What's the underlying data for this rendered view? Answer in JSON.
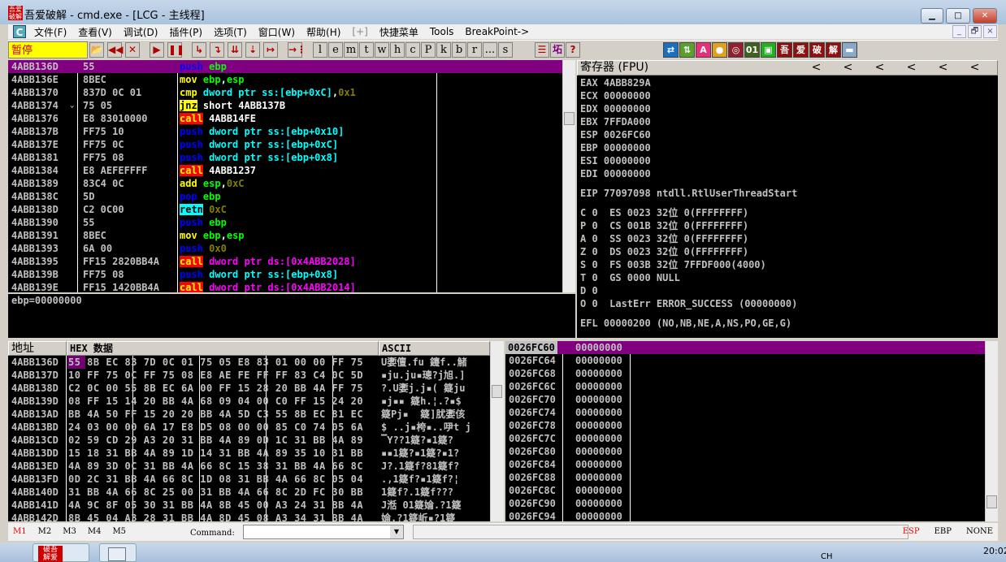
{
  "window": {
    "title": "吾爱破解 - cmd.exe - [LCG -  主线程]",
    "logo_text": "吾爱破解",
    "minimize": "▁",
    "maximize": "□",
    "close": "✕"
  },
  "menu": {
    "logo": "C",
    "items": [
      "文件(F)",
      "查看(V)",
      "调试(D)",
      "插件(P)",
      "选项(T)",
      "窗口(W)",
      "帮助(H)",
      "[+]",
      "快捷菜单",
      "Tools",
      "BreakPoint->"
    ],
    "mdi": [
      "_",
      "🗗",
      "×"
    ]
  },
  "toolbar": {
    "status": "暂停",
    "nav_buttons": [
      "📂",
      "◀◀",
      "✕",
      "▶",
      "❚❚",
      "↳",
      "↴",
      "⇊",
      "⇣",
      "↦",
      "→⋮"
    ],
    "letter_buttons": [
      "l",
      "e",
      "m",
      "t",
      "w",
      "h",
      "c",
      "P",
      "k",
      "b",
      "r",
      "...",
      "s"
    ],
    "extra_buttons": [
      "☰",
      "坧",
      "?"
    ],
    "color_icons": [
      {
        "t": "⇄",
        "c": "#1a6fc0"
      },
      {
        "t": "⇅",
        "c": "#5aa02a"
      },
      {
        "t": "A",
        "c": "#e8307a"
      },
      {
        "t": "●",
        "c": "#e0a020"
      },
      {
        "t": "◎",
        "c": "#902030"
      },
      {
        "t": "01",
        "c": "#406020"
      },
      {
        "t": "▣",
        "c": "#20b020"
      },
      {
        "t": "吾",
        "c": "#901010"
      },
      {
        "t": "爱",
        "c": "#901010"
      },
      {
        "t": "破",
        "c": "#901010"
      },
      {
        "t": "解",
        "c": "#901010"
      },
      {
        "t": "▬",
        "c": "#8aa8c8"
      }
    ]
  },
  "disasm": {
    "rows": [
      {
        "addr": "4ABB136D",
        "hex": "55",
        "mn": "push",
        "ops": [
          [
            "ebp",
            "reg"
          ]
        ]
      },
      {
        "addr": "4ABB136E",
        "hex": "8BEC",
        "mn": "mov",
        "ops": [
          [
            "ebp",
            "reg"
          ],
          [
            ",",
            "p"
          ],
          [
            "esp",
            "reg"
          ]
        ]
      },
      {
        "addr": "4ABB1370",
        "hex": "837D 0C 01",
        "mn": "cmp",
        "ops": [
          [
            "dword ptr ss:[ebp+0xC]",
            "mem"
          ],
          [
            ",",
            "p"
          ],
          [
            "0x1",
            "const"
          ]
        ]
      },
      {
        "addr": "4ABB1374",
        "mark": "⌄",
        "hex": "75 05",
        "mn": "jnz",
        "ops": [
          [
            "short 4ABB137B",
            "addr"
          ]
        ]
      },
      {
        "addr": "4ABB1376",
        "hex": "E8 83010000",
        "mn": "call",
        "ops": [
          [
            "4ABB14FE",
            "addr"
          ]
        ]
      },
      {
        "addr": "4ABB137B",
        "hex": "FF75 10",
        "mn": "push",
        "ops": [
          [
            "dword ptr ss:[ebp+0x10]",
            "mem"
          ]
        ]
      },
      {
        "addr": "4ABB137E",
        "hex": "FF75 0C",
        "mn": "push",
        "ops": [
          [
            "dword ptr ss:[ebp+0xC]",
            "mem"
          ]
        ]
      },
      {
        "addr": "4ABB1381",
        "hex": "FF75 08",
        "mn": "push",
        "ops": [
          [
            "dword ptr ss:[ebp+0x8]",
            "mem"
          ]
        ]
      },
      {
        "addr": "4ABB1384",
        "hex": "E8 AEFEFFFF",
        "mn": "call",
        "ops": [
          [
            "4ABB1237",
            "addr"
          ]
        ]
      },
      {
        "addr": "4ABB1389",
        "hex": "83C4 0C",
        "mn": "add",
        "ops": [
          [
            "esp",
            "reg"
          ],
          [
            ",",
            "p"
          ],
          [
            "0xC",
            "const"
          ]
        ]
      },
      {
        "addr": "4ABB138C",
        "hex": "5D",
        "mn": "pop",
        "ops": [
          [
            "ebp",
            "reg"
          ]
        ]
      },
      {
        "addr": "4ABB138D",
        "hex": "C2 0C00",
        "mn": "retn",
        "ops": [
          [
            "0xC",
            "const"
          ]
        ]
      },
      {
        "addr": "4ABB1390",
        "hex": "55",
        "mn": "push",
        "ops": [
          [
            "ebp",
            "reg"
          ]
        ]
      },
      {
        "addr": "4ABB1391",
        "hex": "8BEC",
        "mn": "mov",
        "ops": [
          [
            "ebp",
            "reg"
          ],
          [
            ",",
            "p"
          ],
          [
            "esp",
            "reg"
          ]
        ]
      },
      {
        "addr": "4ABB1393",
        "hex": "6A 00",
        "mn": "push",
        "ops": [
          [
            "0x0",
            "const"
          ]
        ]
      },
      {
        "addr": "4ABB1395",
        "hex": "FF15 2820BB4A",
        "mn": "call",
        "ops": [
          [
            "dword ptr ds:[0x4ABB2028]",
            "ds"
          ]
        ]
      },
      {
        "addr": "4ABB139B",
        "hex": "FF75 08",
        "mn": "push",
        "ops": [
          [
            "dword ptr ss:[ebp+0x8]",
            "mem"
          ]
        ]
      },
      {
        "addr": "4ABB139E",
        "hex": "FF15 1420BB4A",
        "mn": "call",
        "ops": [
          [
            "dword ptr ds:[0x4ABB2014]",
            "ds"
          ]
        ]
      }
    ],
    "info": "ebp=00000000"
  },
  "registers": {
    "header": "寄存器 (FPU)",
    "arrows": [
      "<",
      "<",
      "<",
      "<",
      "<",
      "<"
    ],
    "lines": [
      "EAX 4ABB829A",
      "ECX 00000000",
      "EDX 00000000",
      "EBX 7FFDA000",
      "ESP 0026FC60",
      "EBP 00000000",
      "ESI 00000000",
      "EDI 00000000",
      "",
      "EIP 77097098 ntdll.RtlUserThreadStart",
      "",
      "C 0  ES 0023 32位 0(FFFFFFFF)",
      "P 0  CS 001B 32位 0(FFFFFFFF)",
      "A 0  SS 0023 32位 0(FFFFFFFF)",
      "Z 0  DS 0023 32位 0(FFFFFFFF)",
      "S 0  FS 003B 32位 7FFDF000(4000)",
      "T 0  GS 0000 NULL",
      "D 0",
      "O 0  LastErr ERROR_SUCCESS (00000000)",
      "",
      "EFL 00000200 (NO,NB,NE,A,NS,PO,GE,G)"
    ]
  },
  "dump": {
    "headers": [
      "地址",
      "HEX 数据",
      "ASCII"
    ],
    "rows": [
      {
        "addr": "4ABB136D",
        "hex": "55 8B EC 83 7D 0C 01 75 05 E8 83 01 00 00 FF 75",
        "ascii": "U嬱儃.fu 鑳f..觰"
      },
      {
        "addr": "4ABB137D",
        "hex": "10 FF 75 0C FF 75 08 E8 AE FE FF FF 83 C4 0C 5D",
        "ascii": "▪ju.ju▪璁?j旭.]"
      },
      {
        "addr": "4ABB138D",
        "hex": "C2 0C 00 55 8B EC 6A 00 FF 15 28 20 BB 4A FF 75",
        "ascii": "?.U嬱j.j▪( 籎ju"
      },
      {
        "addr": "4ABB139D",
        "hex": "08 FF 15 14 20 BB 4A 68 09 04 00 C0 FF 15 24 20",
        "ascii": "▪j▪▪ 籎h.¦.?▪$"
      },
      {
        "addr": "4ABB13AD",
        "hex": "BB 4A 50 FF 15 20 20 BB 4A 5D C3 55 8B EC 81 EC",
        "ascii": "籎Pj▪  籎]肬嬱侅"
      },
      {
        "addr": "4ABB13BD",
        "hex": "24 03 00 00 6A 17 E8 D5 08 00 00 85 C0 74 05 6A",
        "ascii": "$ ..j▪桍▪..吚t j"
      },
      {
        "addr": "4ABB13CD",
        "hex": "02 59 CD 29 A3 20 31 BB 4A 89 0D 1C 31 BB 4A 89",
        "ascii": "▔Y??1籎?▪1籎?"
      },
      {
        "addr": "4ABB13DD",
        "hex": "15 18 31 BB 4A 89 1D 14 31 BB 4A 89 35 10 31 BB",
        "ascii": "▪▪1籎?▪1籎?▪1?"
      },
      {
        "addr": "4ABB13ED",
        "hex": "4A 89 3D 0C 31 BB 4A 66 8C 15 38 31 BB 4A 66 8C",
        "ascii": "J?.1籎f?81籎f?"
      },
      {
        "addr": "4ABB13FD",
        "hex": "0D 2C 31 BB 4A 66 8C 1D 08 31 BB 4A 66 8C 05 04",
        "ascii": ".,1籎f?▪1籎f?¦"
      },
      {
        "addr": "4ABB140D",
        "hex": "31 BB 4A 66 8C 25 00 31 BB 4A 66 8C 2D FC 30 BB",
        "ascii": "1籎f?.1籎f???"
      },
      {
        "addr": "4ABB141D",
        "hex": "4A 9C 8F 05 30 31 BB 4A 8B 45 00 A3 24 31 BB 4A",
        "ascii": "J湉 01籎婨.?1籎"
      },
      {
        "addr": "4ABB142D",
        "hex": "8B 45 04 A3 28 31 BB 4A 8D 45 08 A3 34 31 BB 4A",
        "ascii": "婨.?1籎岴▪?1籎"
      }
    ]
  },
  "stack": {
    "rows": [
      {
        "addr": "0026FC60",
        "val": "00000000"
      },
      {
        "addr": "0026FC64",
        "val": "00000000"
      },
      {
        "addr": "0026FC68",
        "val": "00000000"
      },
      {
        "addr": "0026FC6C",
        "val": "00000000"
      },
      {
        "addr": "0026FC70",
        "val": "00000000"
      },
      {
        "addr": "0026FC74",
        "val": "00000000"
      },
      {
        "addr": "0026FC78",
        "val": "00000000"
      },
      {
        "addr": "0026FC7C",
        "val": "00000000"
      },
      {
        "addr": "0026FC80",
        "val": "00000000"
      },
      {
        "addr": "0026FC84",
        "val": "00000000"
      },
      {
        "addr": "0026FC88",
        "val": "00000000"
      },
      {
        "addr": "0026FC8C",
        "val": "00000000"
      },
      {
        "addr": "0026FC90",
        "val": "00000000"
      },
      {
        "addr": "0026FC94",
        "val": "00000000"
      }
    ]
  },
  "bottom": {
    "marks": [
      "M1",
      "M2",
      "M3",
      "M4",
      "M5"
    ],
    "command_label": "Command:",
    "command_value": "",
    "stack_modes": [
      "ESP",
      "EBP",
      "NONE"
    ]
  },
  "taskbar": {
    "tray_lang": "CH",
    "clock": "20:02"
  }
}
